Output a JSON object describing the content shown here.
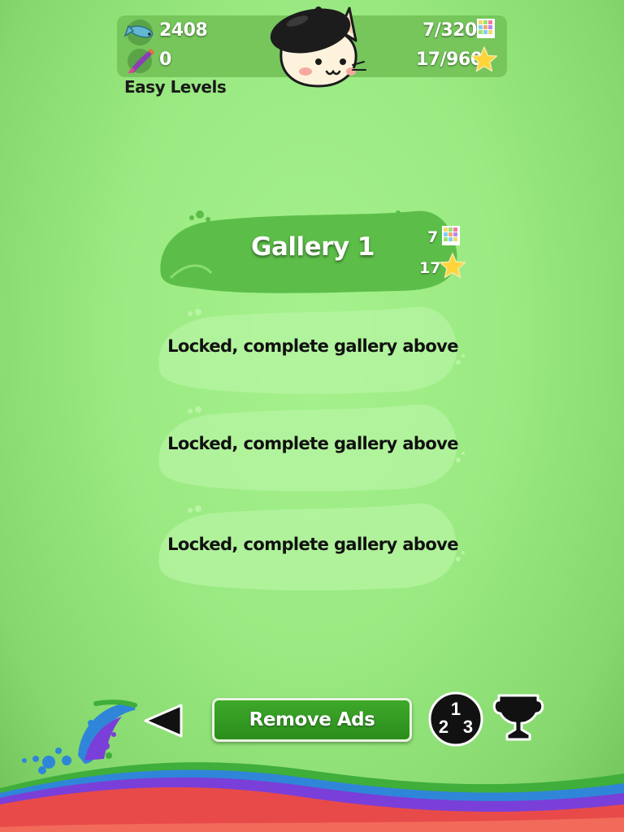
{
  "header": {
    "fish_count": "2408",
    "paintbrush_count": "0",
    "puzzles_progress": "7/320",
    "stars_progress": "17/960",
    "subtitle": "Easy Levels"
  },
  "galleries": [
    {
      "title": "Gallery 1",
      "puzzles": "7",
      "stars": "17",
      "locked": false
    },
    {
      "locked_text": "Locked, complete gallery above",
      "locked": true
    },
    {
      "locked_text": "Locked, complete gallery above",
      "locked": true
    },
    {
      "locked_text": "Locked, complete gallery above",
      "locked": true
    }
  ],
  "footer": {
    "remove_ads_label": "Remove Ads",
    "leaderboard_digits": [
      "1",
      "2",
      "3"
    ]
  },
  "icons": {
    "fish": "fish-icon",
    "paintbrush": "paintbrush-icon",
    "puzzle": "puzzle-grid-icon",
    "star": "star-icon",
    "back": "back-arrow-icon",
    "leaderboard": "leaderboard-icon",
    "trophy": "trophy-icon",
    "mascot": "cat-mascot-icon"
  },
  "colors": {
    "background": "#9ae982",
    "button_green": "#3ea92a",
    "banner_green": "#5cbe48"
  }
}
